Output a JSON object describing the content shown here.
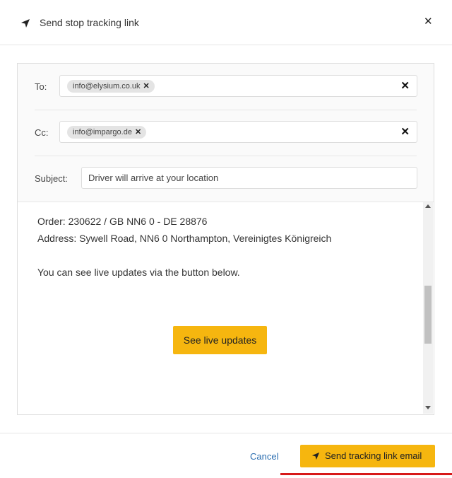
{
  "dialog": {
    "title": "Send stop tracking link",
    "close_glyph": "✕"
  },
  "form": {
    "to": {
      "label": "To:",
      "chips": [
        "info@elysium.co.uk"
      ],
      "chip_remove_glyph": "✕",
      "clear_glyph": "✕"
    },
    "cc": {
      "label": "Cc:",
      "chips": [
        "info@impargo.de"
      ],
      "chip_remove_glyph": "✕",
      "clear_glyph": "✕"
    },
    "subject": {
      "label": "Subject:",
      "value": "Driver will arrive at your location"
    }
  },
  "email_body": {
    "line1": "Order: 230622 / GB NN6 0 - DE 28876",
    "line2": "Address: Sywell Road, NN6 0 Northampton, Vereinigtes Königreich",
    "line3": "You can see live updates via the button below.",
    "live_button_label": "See live updates"
  },
  "footer": {
    "cancel_label": "Cancel",
    "send_label": "Send tracking link email"
  },
  "colors": {
    "accent": "#f6b60f",
    "link": "#2a6db0",
    "highlight": "#d71a1a"
  },
  "icons": {
    "header": "navigation-arrow-icon",
    "send": "navigation-arrow-icon"
  }
}
